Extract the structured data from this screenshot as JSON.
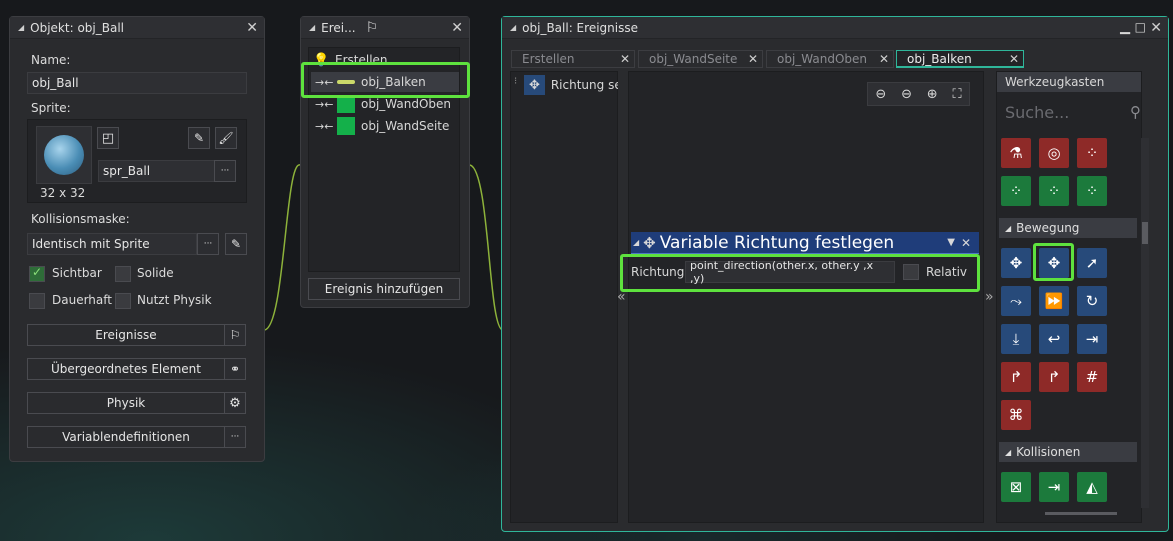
{
  "object_panel": {
    "title": "Objekt: obj_Ball",
    "name_label": "Name:",
    "name_value": "obj_Ball",
    "sprite_label": "Sprite:",
    "sprite_value": "spr_Ball",
    "sprite_size": "32 x 32",
    "collision_label": "Kollisionsmaske:",
    "collision_value": "Identisch mit Sprite",
    "visible_label": "Sichtbar",
    "solid_label": "Solide",
    "persistent_label": "Dauerhaft",
    "physics_use_label": "Nutzt Physik",
    "events_button": "Ereignisse",
    "parent_button": "Übergeordnetes Element",
    "physics_button": "Physik",
    "variables_button": "Variablendefinitionen",
    "ellipsis": "···"
  },
  "events_panel": {
    "title": "Erei...",
    "items": [
      {
        "label": "Erstellen"
      },
      {
        "label": "obj_Balken"
      },
      {
        "label": "obj_WandOben"
      },
      {
        "label": "obj_WandSeite"
      }
    ],
    "add_button": "Ereignis hinzufügen"
  },
  "editor_panel": {
    "title": "obj_Ball: Ereignisse",
    "tabs": [
      {
        "label": "Erstellen"
      },
      {
        "label": "obj_WandSeite"
      },
      {
        "label": "obj_WandOben"
      },
      {
        "label": "obj_Balken"
      }
    ],
    "list_item": "Richtung se",
    "action_title": "Variable Richtung festlegen",
    "param_label": "Richtung",
    "param_value": "point_direction(other.x, other.y ,x ,y)",
    "relative_label": "Relativ",
    "nav_left": "«",
    "nav_right": "»"
  },
  "toolbox": {
    "title": "Werkzeugkasten",
    "search_placeholder": "Suche...",
    "section_movement": "Bewegung",
    "section_collisions": "Kollisionen"
  },
  "colors": {
    "highlight": "#5ee23e",
    "accent": "#2fb69a",
    "action_header": "#1f3d7a"
  }
}
